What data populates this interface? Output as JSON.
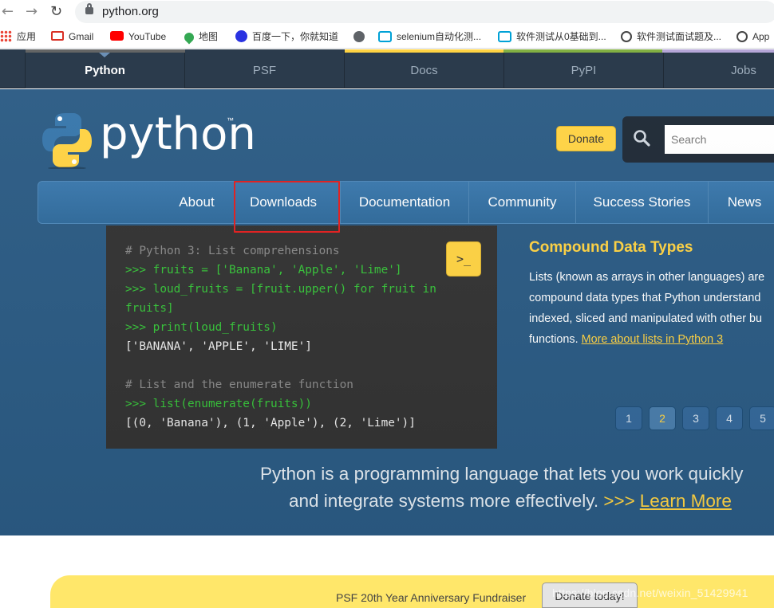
{
  "browser": {
    "back_icon": "back-arrow-icon",
    "forward_icon": "forward-arrow-icon",
    "reload_icon": "reload-icon",
    "url": "python.org",
    "bookmarks": [
      {
        "label": "应用",
        "icon": "apps-grid-icon"
      },
      {
        "label": "Gmail",
        "icon": "gmail-icon"
      },
      {
        "label": "YouTube",
        "icon": "youtube-icon"
      },
      {
        "label": "地图",
        "icon": "maps-pin-icon"
      },
      {
        "label": "百度一下，你就知道",
        "icon": "baidu-paw-icon"
      },
      {
        "label": "",
        "icon": "globe-icon"
      },
      {
        "label": "selenium自动化测...",
        "icon": "bilibili-tv-icon"
      },
      {
        "label": "软件测试从0基础到...",
        "icon": "bilibili-tv-icon"
      },
      {
        "label": "软件测试面试题及...",
        "icon": "bookmark-logo-icon"
      },
      {
        "label": "App",
        "icon": "bookmark-logo-icon"
      }
    ]
  },
  "topnav": {
    "tabs": [
      "Python",
      "PSF",
      "Docs",
      "PyPI",
      "Jobs"
    ],
    "active": "Python",
    "accent_colors": [
      "#646565",
      "#ffd343",
      "#82b043",
      "#b55863",
      "#b5a6d7"
    ]
  },
  "header": {
    "logo_text": "python",
    "trademark": "™",
    "donate_label": "Donate",
    "search_placeholder": "Search"
  },
  "main_menu": {
    "items": [
      "About",
      "Downloads",
      "Documentation",
      "Community",
      "Success Stories",
      "News"
    ],
    "highlighted": "Downloads"
  },
  "code_panel": {
    "shell_button": ">_",
    "lines": [
      {
        "kind": "comment",
        "text": "# Python 3: List comprehensions"
      },
      {
        "kind": "prompt",
        "text": ">>> fruits = ['Banana', 'Apple', 'Lime']"
      },
      {
        "kind": "prompt",
        "text": ">>> loud_fruits = [fruit.upper() for fruit in"
      },
      {
        "kind": "prompt",
        "text": "fruits]"
      },
      {
        "kind": "prompt",
        "text": ">>> print(loud_fruits)"
      },
      {
        "kind": "out",
        "text": "['BANANA', 'APPLE', 'LIME']"
      },
      {
        "kind": "blank",
        "text": ""
      },
      {
        "kind": "comment",
        "text": "# List and the enumerate function"
      },
      {
        "kind": "prompt",
        "text": ">>> list(enumerate(fruits))"
      },
      {
        "kind": "out",
        "text": "[(0, 'Banana'), (1, 'Apple'), (2, 'Lime')]"
      }
    ]
  },
  "slide": {
    "title": "Compound Data Types",
    "body_lines": [
      "Lists (known as arrays in other languages) are",
      "compound data types that Python understand",
      "indexed, sliced and manipulated with other bu",
      "functions."
    ],
    "link": "More about lists in Python 3",
    "pager": [
      "1",
      "2",
      "3",
      "4",
      "5"
    ],
    "active_page": "2"
  },
  "intro": {
    "line1": "Python is a programming language that lets you work quickly",
    "line2": "and integrate systems more effectively.",
    "arrows": ">>>",
    "learn_more": "Learn More"
  },
  "banner": {
    "text": "PSF 20th Year Anniversary Fundraiser",
    "button": "Donate today!",
    "watermark": "https://blog.csdn.net/weixin_51429941"
  },
  "colors": {
    "accent_yellow": "#ffd343",
    "header_blue": "#2b5b84",
    "nav_dark": "#2b3b4c",
    "highlight_red": "#e02323"
  }
}
